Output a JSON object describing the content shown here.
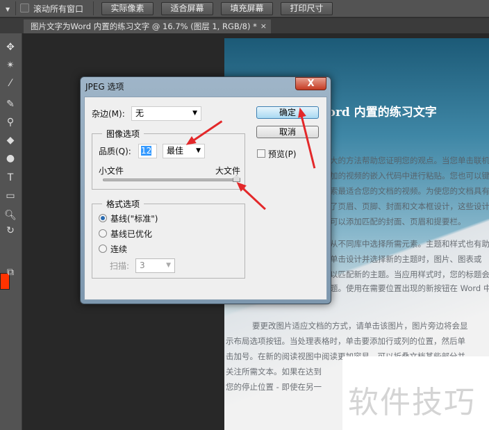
{
  "options_bar": {
    "scroll_all_label": "滚动所有窗口",
    "buttons": [
      "实际像素",
      "适合屏幕",
      "填充屏幕",
      "打印尺寸"
    ]
  },
  "document_tab": {
    "title": "图片文字为Word 内置的练习文字 @ 16.7% (图层 1, RGB/8) *",
    "close": "×"
  },
  "tools": [
    "move-icon",
    "magic-wand-icon",
    "eyedropper-icon",
    "brush-icon",
    "stamp-icon",
    "paint-bucket-icon",
    "dodge-icon",
    "type-icon",
    "rectangle-icon",
    "zoom-icon",
    "rotate-icon"
  ],
  "colors": {
    "foreground": "#ff3300",
    "accent_arrow": "#e3282a"
  },
  "canvas": {
    "title": "为 Word 内置的练习文字",
    "para1": [
      "大的方法帮助您证明您的观点。当您单击联机",
      "加的视频的嵌入代码中进行粘贴。您也可以键",
      "索最适合您的文档的视频。为使您的文档具有",
      "了页眉、页脚、封面和文本框设计，这些设计",
      "可以添加匹配的封面、页眉和提要栏。"
    ],
    "para2": [
      "从不同库中选择所需元素。主题和样式也有助",
      "单击设计并选择新的主题时，图片、图表或",
      "以匹配新的主题。当应用样式时，您的标题会",
      "题。使用在需要位置出现的新按钮在 Word 中"
    ],
    "para3": [
      "要更改图片适应文档的方式，请单击该图片，图片旁边将会显",
      "示布局选项按钮。当处理表格时，单击要添加行或列的位置，然后单",
      "击加号。在新的阅读视图中阅读更加容易。可以折叠文档某些部分并",
      "关注所需文本。如果在达到",
      "您的停止位置 - 即使在另一"
    ]
  },
  "watermark": "软件技巧",
  "dialog": {
    "title": "JPEG 选项",
    "close": "X",
    "matte_label": "杂边(M):",
    "matte_value": "无",
    "image_options_title": "图像选项",
    "quality_label": "品质(Q):",
    "quality_value": "12",
    "quality_preset": "最佳",
    "small_file": "小文件",
    "large_file": "大文件",
    "quality_slider_fraction": 1.0,
    "format_options_title": "格式选项",
    "format_options": [
      {
        "label": "基线(\"标准\")",
        "selected": true
      },
      {
        "label": "基线已优化",
        "selected": false
      },
      {
        "label": "连续",
        "selected": false
      }
    ],
    "scans_label": "扫描:",
    "scans_value": "3",
    "ok": "确定",
    "cancel": "取消",
    "preview_label": "预览(P)",
    "preview_checked": false
  }
}
